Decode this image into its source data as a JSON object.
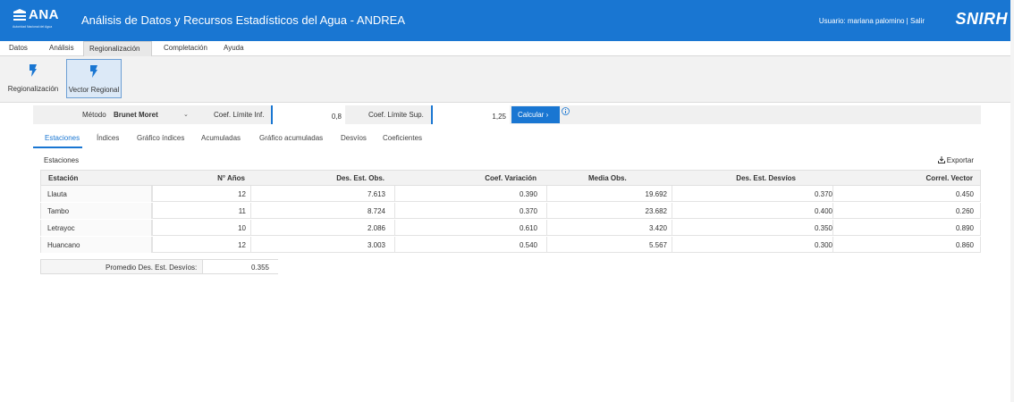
{
  "header": {
    "logo_text": "ANA",
    "logo_subtext": "Autoridad Nacional del Agua",
    "title": "Análisis de Datos y Recursos Estadísticos del Agua - ANDREA",
    "user_text": "Usuario: mariana palomino | Salir",
    "brand": "SNIRH",
    "colors": {
      "header_bg": "#1976d2",
      "accent": "#1976d2"
    }
  },
  "menu": {
    "items": [
      {
        "label": "Datos"
      },
      {
        "label": "Análisis"
      },
      {
        "label": "Regionalización",
        "active": true
      },
      {
        "label": "Completación"
      },
      {
        "label": "Ayuda"
      }
    ]
  },
  "ribbon": {
    "buttons": [
      {
        "label": "Regionalización",
        "icon": "lightning-icon",
        "active": false
      },
      {
        "label": "Vector Regional",
        "icon": "lightning-icon",
        "active": true
      }
    ]
  },
  "params": {
    "metodo_label": "Método",
    "metodo_value": "Brunet Moret",
    "lim_inf_label": "Coef. Límite Inf.",
    "lim_inf_value": "0,8",
    "lim_sup_label": "Coef. Límite Sup.",
    "lim_sup_value": "1,25",
    "calc_label": "Calcular ›",
    "info_icon": "info-icon"
  },
  "tabs": [
    {
      "label": "Estaciones",
      "active": true
    },
    {
      "label": "Índices"
    },
    {
      "label": "Gráfico índices"
    },
    {
      "label": "Acumuladas"
    },
    {
      "label": "Gráfico acumuladas"
    },
    {
      "label": "Desvíos"
    },
    {
      "label": "Coeficientes"
    }
  ],
  "panel": {
    "title": "Estaciones",
    "export_label": "Exportar",
    "export_icon": "download-icon"
  },
  "table": {
    "columns": [
      "Estación",
      "N° Años",
      "Des. Est. Obs.",
      "Coef. Variación",
      "Media Obs.",
      "Des. Est. Desvíos",
      "Correl. Vector"
    ],
    "rows": [
      [
        "Llauta",
        "12",
        "7.613",
        "0.390",
        "19.692",
        "0.370",
        "0.450"
      ],
      [
        "Tambo",
        "11",
        "8.724",
        "0.370",
        "23.682",
        "0.400",
        "0.260"
      ],
      [
        "Letrayoc",
        "10",
        "2.086",
        "0.610",
        "3.420",
        "0.350",
        "0.890"
      ],
      [
        "Huancano",
        "12",
        "3.003",
        "0.540",
        "5.567",
        "0.300",
        "0.860"
      ]
    ]
  },
  "promedio": {
    "label": "Promedio Des. Est. Desvíos:",
    "value": "0.355"
  }
}
